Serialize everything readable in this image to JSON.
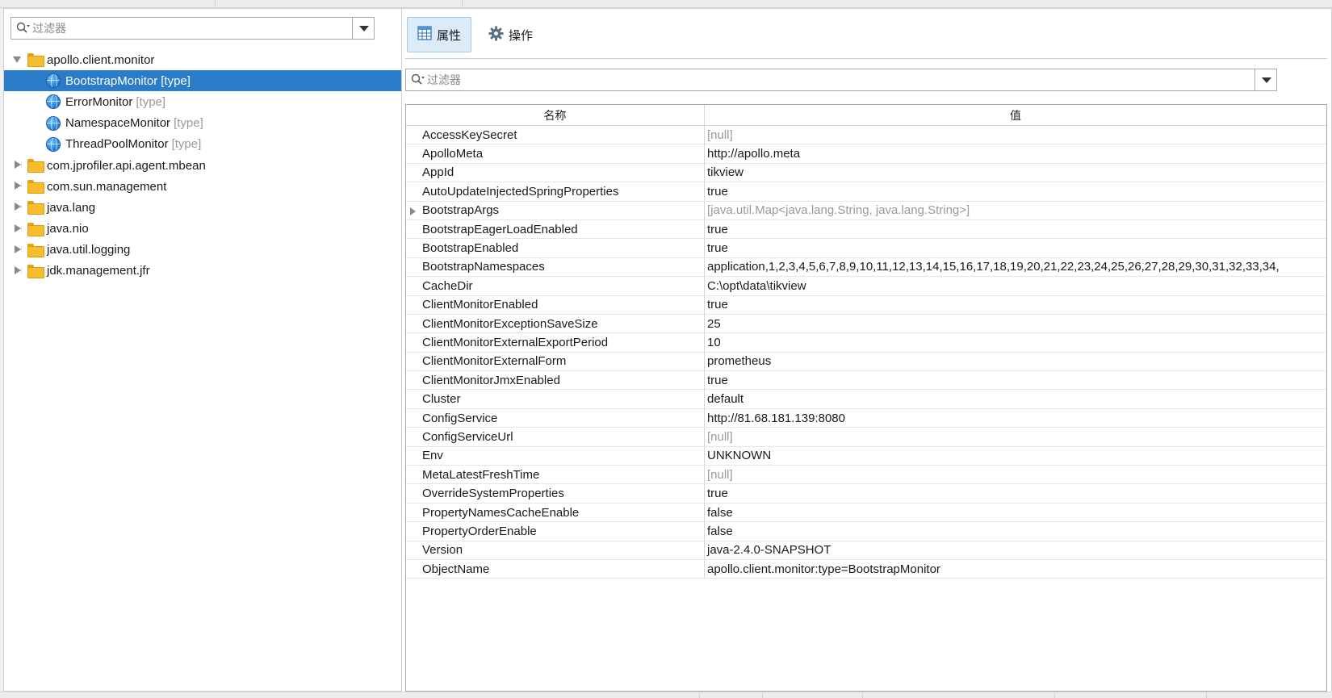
{
  "left_filter": {
    "placeholder": "过滤器"
  },
  "tree": [
    {
      "label": "apollo.client.monitor",
      "kind": "package",
      "expanded": true
    },
    {
      "label": "BootstrapMonitor",
      "tag": "[type]",
      "kind": "mbean",
      "selected": true
    },
    {
      "label": "ErrorMonitor",
      "tag": "[type]",
      "kind": "mbean"
    },
    {
      "label": "NamespaceMonitor",
      "tag": "[type]",
      "kind": "mbean"
    },
    {
      "label": "ThreadPoolMonitor",
      "tag": "[type]",
      "kind": "mbean"
    },
    {
      "label": "com.jprofiler.api.agent.mbean",
      "kind": "package",
      "expanded": false
    },
    {
      "label": "com.sun.management",
      "kind": "package",
      "expanded": false
    },
    {
      "label": "java.lang",
      "kind": "package",
      "expanded": false
    },
    {
      "label": "java.nio",
      "kind": "package",
      "expanded": false
    },
    {
      "label": "java.util.logging",
      "kind": "package",
      "expanded": false
    },
    {
      "label": "jdk.management.jfr",
      "kind": "package",
      "expanded": false
    }
  ],
  "tabs": {
    "attributes": "属性",
    "operations": "操作"
  },
  "right_filter": {
    "placeholder": "过滤器"
  },
  "grid": {
    "col_name": "名称",
    "col_value": "值",
    "rows": [
      {
        "name": "AccessKeySecret",
        "value": "[null]",
        "muted": true
      },
      {
        "name": "ApolloMeta",
        "value": "http://apollo.meta"
      },
      {
        "name": "AppId",
        "value": "tikview"
      },
      {
        "name": "AutoUpdateInjectedSpringProperties",
        "value": "true"
      },
      {
        "name": "BootstrapArgs",
        "value": "[java.util.Map<java.lang.String, java.lang.String>]",
        "muted": true,
        "expandable": true
      },
      {
        "name": "BootstrapEagerLoadEnabled",
        "value": "true"
      },
      {
        "name": "BootstrapEnabled",
        "value": "true"
      },
      {
        "name": "BootstrapNamespaces",
        "value": "application,1,2,3,4,5,6,7,8,9,10,11,12,13,14,15,16,17,18,19,20,21,22,23,24,25,26,27,28,29,30,31,32,33,34,"
      },
      {
        "name": "CacheDir",
        "value": "C:\\opt\\data\\tikview"
      },
      {
        "name": "ClientMonitorEnabled",
        "value": "true"
      },
      {
        "name": "ClientMonitorExceptionSaveSize",
        "value": "25"
      },
      {
        "name": "ClientMonitorExternalExportPeriod",
        "value": "10"
      },
      {
        "name": "ClientMonitorExternalForm",
        "value": "prometheus"
      },
      {
        "name": "ClientMonitorJmxEnabled",
        "value": "true"
      },
      {
        "name": "Cluster",
        "value": "default"
      },
      {
        "name": "ConfigService",
        "value": "http://81.68.181.139:8080"
      },
      {
        "name": "ConfigServiceUrl",
        "value": "[null]",
        "muted": true
      },
      {
        "name": "Env",
        "value": "UNKNOWN"
      },
      {
        "name": "MetaLatestFreshTime",
        "value": "[null]",
        "muted": true
      },
      {
        "name": "OverrideSystemProperties",
        "value": "true"
      },
      {
        "name": "PropertyNamesCacheEnable",
        "value": "false"
      },
      {
        "name": "PropertyOrderEnable",
        "value": "false"
      },
      {
        "name": "Version",
        "value": "java-2.4.0-SNAPSHOT"
      },
      {
        "name": "ObjectName",
        "value": "apollo.client.monitor:type=BootstrapMonitor"
      }
    ]
  },
  "colors": {
    "selection": "#2a7bc8",
    "active_tab": "#dcebf8",
    "folder": "#f6bd2e"
  },
  "icons": {
    "filter": "search-icon",
    "package": "folder-icon",
    "mbean": "globe-icon",
    "attributes_tab": "table-icon",
    "operations_tab": "gear-icon"
  }
}
